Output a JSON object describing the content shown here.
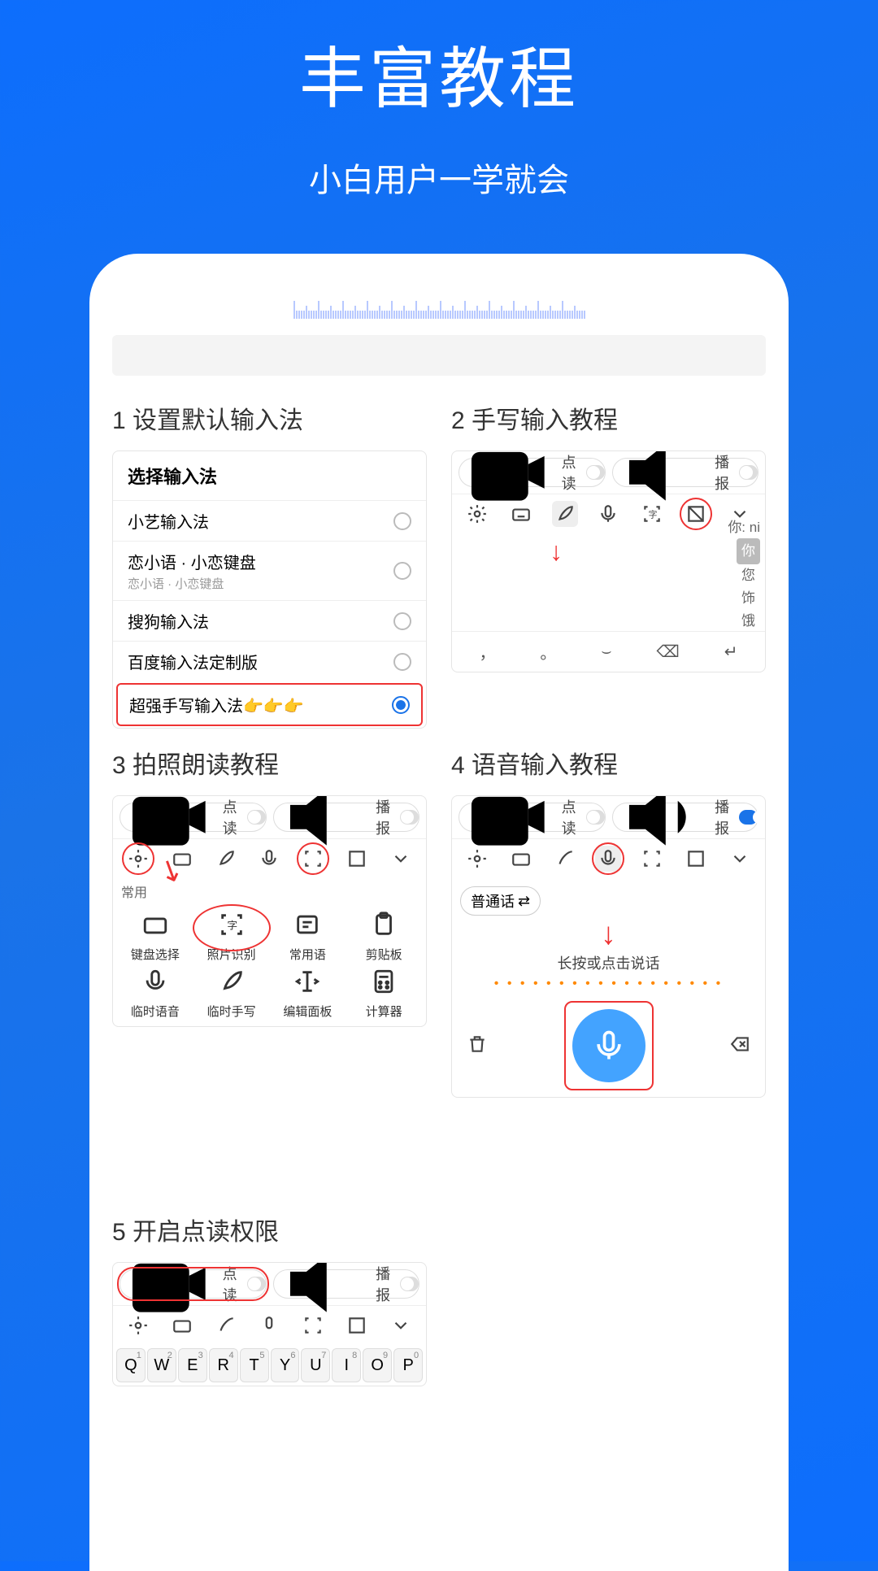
{
  "header": {
    "title": "丰富教程",
    "subtitle": "小白用户一学就会"
  },
  "tutorials": [
    {
      "num": "1",
      "title": "设置默认输入法"
    },
    {
      "num": "2",
      "title": "手写输入教程"
    },
    {
      "num": "3",
      "title": "拍照朗读教程"
    },
    {
      "num": "4",
      "title": "语音输入教程"
    },
    {
      "num": "5",
      "title": "开启点读权限"
    }
  ],
  "card1": {
    "heading": "选择输入法",
    "items": [
      {
        "label": "小艺输入法",
        "sub": ""
      },
      {
        "label": "恋小语 · 小恋键盘",
        "sub": "恋小语 · 小恋键盘"
      },
      {
        "label": "搜狗输入法",
        "sub": ""
      },
      {
        "label": "百度输入法定制版",
        "sub": ""
      },
      {
        "label": "超强手写输入法👉👉👉",
        "sub": "",
        "selected": true
      }
    ]
  },
  "pill_read": "点读",
  "pill_speak": "播报",
  "card2": {
    "pinyin": "你: ni",
    "candidates": [
      "你",
      "您",
      "饰",
      "饿"
    ]
  },
  "card3": {
    "group_label": "常用",
    "items": [
      "键盘选择",
      "照片识别",
      "常用语",
      "剪贴板",
      "临时语音",
      "临时手写",
      "编辑面板",
      "计算器"
    ]
  },
  "card4": {
    "lang": "普通话",
    "hint": "长按或点击说话"
  },
  "qwerty": [
    "Q",
    "W",
    "E",
    "R",
    "T",
    "Y",
    "U",
    "I",
    "O",
    "P"
  ],
  "qwerty_nums": [
    "1",
    "2",
    "3",
    "4",
    "5",
    "6",
    "7",
    "8",
    "9",
    "0"
  ]
}
